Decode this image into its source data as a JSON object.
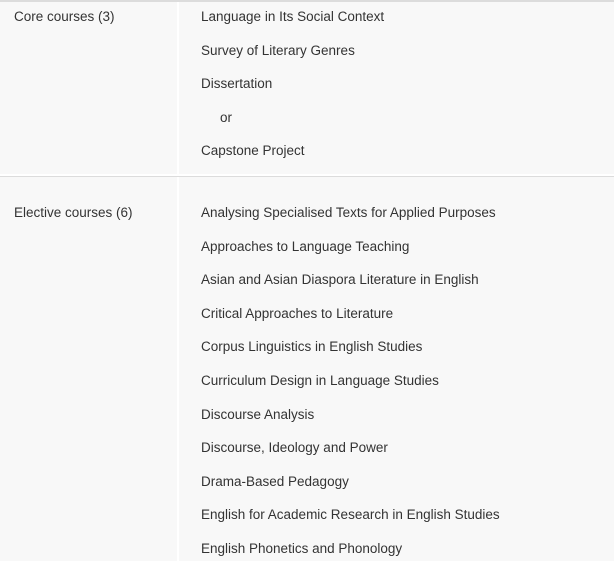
{
  "sections": [
    {
      "category": "Core courses (3)",
      "courses": [
        {
          "label": "Language in Its Social Context"
        },
        {
          "label": "Survey of Literary Genres"
        },
        {
          "label": "Dissertation"
        },
        {
          "label": "or",
          "indent": true
        },
        {
          "label": "Capstone Project"
        }
      ]
    },
    {
      "category": "Elective courses (6)",
      "courses": [
        {
          "label": "Analysing Specialised Texts for Applied Purposes"
        },
        {
          "label": "Approaches to Language Teaching"
        },
        {
          "label": "Asian and Asian Diaspora Literature in English"
        },
        {
          "label": "Critical Approaches to Literature"
        },
        {
          "label": "Corpus Linguistics in English Studies"
        },
        {
          "label": "Curriculum Design in Language Studies"
        },
        {
          "label": "Discourse Analysis"
        },
        {
          "label": "Discourse, Ideology and Power"
        },
        {
          "label": "Drama-Based Pedagogy"
        },
        {
          "label": "English for Academic Research in English Studies"
        },
        {
          "label": "English Phonetics and Phonology"
        }
      ]
    }
  ]
}
